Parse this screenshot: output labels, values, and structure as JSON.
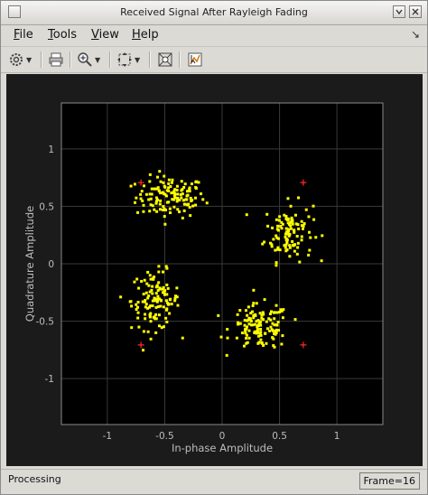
{
  "window": {
    "title": "Received Signal After Rayleigh Fading"
  },
  "menus": [
    {
      "label": "File"
    },
    {
      "label": "Tools"
    },
    {
      "label": "View"
    },
    {
      "label": "Help"
    }
  ],
  "toolbar": {
    "icons": [
      "gear-icon",
      "print-icon",
      "zoom-icon",
      "pan-icon",
      "data-cursor-icon",
      "edit-plot-icon"
    ]
  },
  "status": {
    "text": "Processing",
    "frame": "Frame=16"
  },
  "chart_data": {
    "type": "scatter",
    "xlabel": "In-phase Amplitude",
    "ylabel": "Quadrature Amplitude",
    "xlim": [
      -1.4,
      1.4
    ],
    "ylim": [
      -1.4,
      1.4
    ],
    "xticks": [
      -1,
      -0.5,
      0,
      0.5,
      1
    ],
    "yticks": [
      -1,
      -0.5,
      0,
      0.5,
      1
    ],
    "grid": true,
    "colors": {
      "points": "#ffff00",
      "reference": "#ff2a2a",
      "axes_bg": "#000000",
      "grid": "#3a3a3a",
      "tick": "#bdbdbd"
    },
    "reference": [
      [
        -0.707,
        0.707
      ],
      [
        0.707,
        0.707
      ],
      [
        -0.707,
        -0.707
      ],
      [
        0.707,
        -0.707
      ]
    ],
    "clusters": [
      {
        "center": [
          -0.45,
          0.58
        ],
        "spread": [
          0.2,
          0.12
        ],
        "count": 130
      },
      {
        "center": [
          0.58,
          0.28
        ],
        "spread": [
          0.14,
          0.17
        ],
        "count": 110
      },
      {
        "center": [
          -0.58,
          -0.32
        ],
        "spread": [
          0.14,
          0.17
        ],
        "count": 120
      },
      {
        "center": [
          0.33,
          -0.55
        ],
        "spread": [
          0.17,
          0.13
        ],
        "count": 125
      }
    ]
  }
}
